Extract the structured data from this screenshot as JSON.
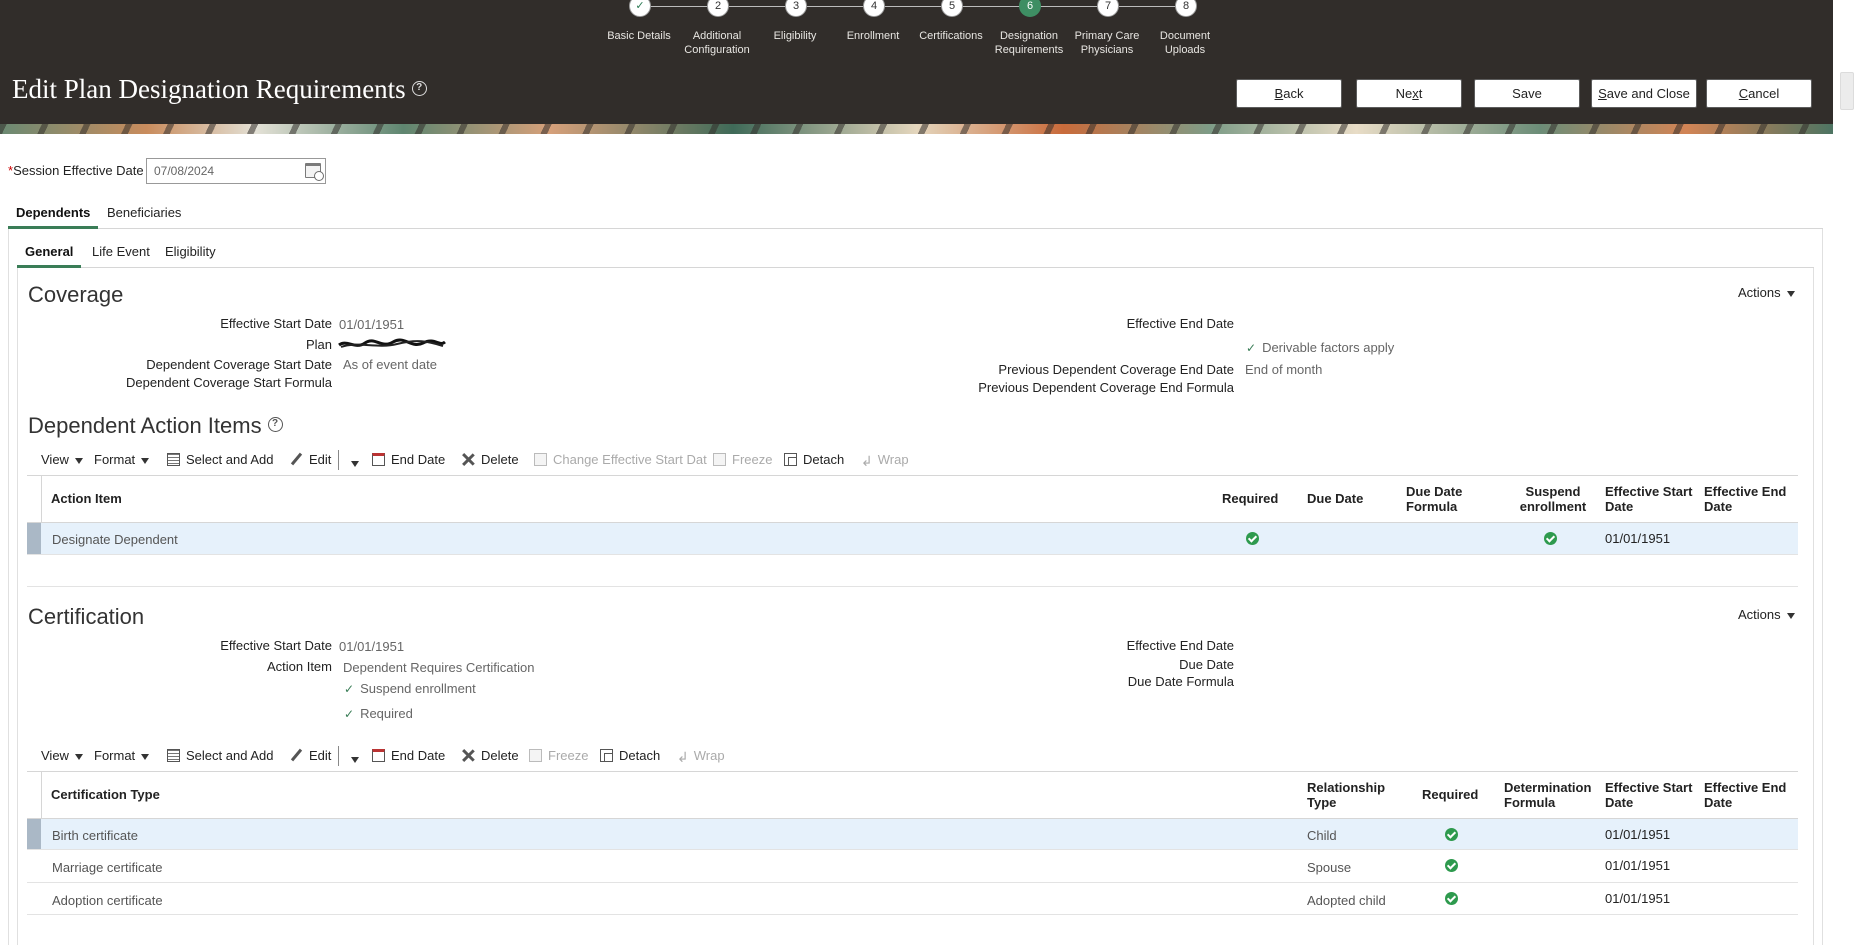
{
  "header": {
    "title": "Edit Plan Designation Requirements",
    "buttons": {
      "back_ul": "B",
      "back_rest": "ack",
      "next_pre": "Ne",
      "next_ul": "x",
      "next_rest": "t",
      "save": "Save",
      "save_close_ul": "S",
      "save_close_rest": "ave and Close",
      "cancel_ul": "C",
      "cancel_rest": "ancel"
    },
    "train": [
      {
        "num": "✓",
        "label": "Basic Details"
      },
      {
        "num": "2",
        "label": "Additional Configuration"
      },
      {
        "num": "3",
        "label": "Eligibility"
      },
      {
        "num": "4",
        "label": "Enrollment"
      },
      {
        "num": "5",
        "label": "Certifications"
      },
      {
        "num": "6",
        "label": "Designation Requirements"
      },
      {
        "num": "7",
        "label": "Primary Care Physicians"
      },
      {
        "num": "8",
        "label": "Document Uploads"
      }
    ]
  },
  "session": {
    "required_mark": "*",
    "label": "Session Effective Date",
    "value": "07/08/2024"
  },
  "tabs": {
    "dependents": "Dependents",
    "beneficiaries": "Beneficiaries",
    "general": "General",
    "life_event": "Life Event",
    "eligibility": "Eligibility"
  },
  "coverage": {
    "title": "Coverage",
    "actions": "Actions",
    "effective_start_date_label": "Effective Start Date",
    "effective_start_date": "01/01/1951",
    "plan_label": "Plan",
    "dep_cov_start_date_label": "Dependent Coverage Start Date",
    "dep_cov_start_date": "As of event date",
    "dep_cov_start_formula_label": "Dependent Coverage Start Formula",
    "effective_end_date_label": "Effective End Date",
    "derivable_factors": "Derivable factors apply",
    "prev_dep_cov_end_date_label": "Previous Dependent Coverage End Date",
    "prev_dep_cov_end_date": "End of month",
    "prev_dep_cov_end_formula_label": "Previous Dependent Coverage End Formula"
  },
  "dependent_action_items": {
    "title": "Dependent Action Items",
    "toolbar": {
      "view": "View",
      "format": "Format",
      "select_add": "Select and Add",
      "edit": "Edit",
      "end_date": "End Date",
      "delete": "Delete",
      "change_start": "Change Effective Start Dat",
      "freeze": "Freeze",
      "detach": "Detach",
      "wrap": "Wrap"
    },
    "columns": {
      "action_item": "Action Item",
      "required": "Required",
      "due_date": "Due Date",
      "due_date_formula": "Due Date Formula",
      "suspend": "Suspend enrollment",
      "eff_start": "Effective Start Date",
      "eff_end": "Effective End Date"
    },
    "rows": [
      {
        "action_item": "Designate Dependent",
        "required": true,
        "suspend": true,
        "eff_start": "01/01/1951",
        "eff_end": ""
      }
    ]
  },
  "certification": {
    "title": "Certification",
    "actions": "Actions",
    "effective_start_date_label": "Effective Start Date",
    "effective_start_date": "01/01/1951",
    "action_item_label": "Action Item",
    "action_item": "Dependent Requires Certification",
    "suspend_enrollment": "Suspend enrollment",
    "required": "Required",
    "effective_end_date_label": "Effective End Date",
    "due_date_label": "Due Date",
    "due_date_formula_label": "Due Date Formula",
    "toolbar": {
      "view": "View",
      "format": "Format",
      "select_add": "Select and Add",
      "edit": "Edit",
      "end_date": "End Date",
      "delete": "Delete",
      "freeze": "Freeze",
      "detach": "Detach",
      "wrap": "Wrap"
    },
    "columns": {
      "cert_type": "Certification Type",
      "relationship": "Relationship Type",
      "required": "Required",
      "determination": "Determination Formula",
      "eff_start": "Effective Start Date",
      "eff_end": "Effective End Date"
    },
    "rows": [
      {
        "cert_type": "Birth certificate",
        "relationship": "Child",
        "required": true,
        "eff_start": "01/01/1951"
      },
      {
        "cert_type": "Marriage certificate",
        "relationship": "Spouse",
        "required": true,
        "eff_start": "01/01/1951"
      },
      {
        "cert_type": "Adoption certificate",
        "relationship": "Adopted child",
        "required": true,
        "eff_start": "01/01/1951"
      }
    ]
  },
  "colors": {
    "header_bg": "#312d2a",
    "accent_green": "#3a7d57",
    "check_green": "#2e9a4e",
    "selected_row": "#e6f1fb"
  }
}
